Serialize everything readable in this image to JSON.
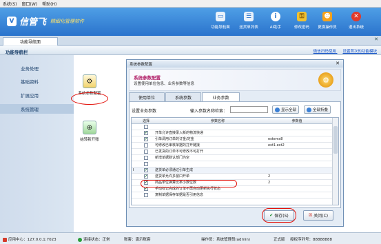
{
  "menu": [
    "系统(S)",
    "窗口(W)",
    "帮助(H)"
  ],
  "brand": {
    "name": "信管飞",
    "slogan": "精细化管理软件"
  },
  "toolbar": [
    {
      "label": "功能导航面",
      "icon": "monitor-icon",
      "color": "#ffffff"
    },
    {
      "label": "送货单列表",
      "icon": "list-icon",
      "color": "#ffffff"
    },
    {
      "label": "AI助手",
      "icon": "info-icon",
      "color": "#ffffff"
    },
    {
      "label": "修改密码",
      "icon": "key-icon",
      "color": "#f2c230"
    },
    {
      "label": "更换操作员",
      "icon": "user-icon",
      "color": "#f7a21b"
    },
    {
      "label": "退出系统",
      "icon": "close-icon",
      "color": "#e23a2a"
    }
  ],
  "tabs": {
    "home": "功能导航面"
  },
  "nav": {
    "title": "功能导航栏",
    "links": [
      "微信扫码使用",
      "设置首次的功能模块"
    ]
  },
  "sidebar": [
    "业务处理",
    "基础资料",
    "扩展应用",
    "系统管理"
  ],
  "functions": [
    {
      "label": "系统参数配置",
      "icon": "db-gear-icon"
    },
    {
      "label": "结转新开账",
      "icon": "db-add-icon"
    }
  ],
  "dialog": {
    "title": "系统参数配置",
    "header_title": "系统参数配置",
    "header_subtitle": "设置使用单位信息、业务参数等信息",
    "tabs": [
      "使用单位",
      "系统参数",
      "业务参数"
    ],
    "active_tab": 2,
    "set_label": "设置业务参数",
    "search_label": "输入参数名称检索：",
    "search_value": "",
    "show_all": "显示全部",
    "select_all": "全部折叠",
    "columns": [
      "选择",
      "参数名称",
      "参数值"
    ],
    "rows": [
      {
        "mark": "",
        "checked": false,
        "name": "",
        "value": ""
      },
      {
        "mark": "",
        "checked": true,
        "name": "开单允许直接录入新的物流快递",
        "value": ""
      },
      {
        "mark": "",
        "checked": true,
        "name": "引单调用订单的订金/定金",
        "value": "estems8"
      },
      {
        "mark": "",
        "checked": false,
        "name": "可修改已审核单据的打开链接",
        "value": "ext1.ext2"
      },
      {
        "mark": "",
        "checked": false,
        "name": "已发货的订单不可修改不可打开",
        "value": ""
      },
      {
        "mark": "",
        "checked": false,
        "name": "新增单据默认部门为空",
        "value": ""
      },
      {
        "mark": "",
        "checked": false,
        "name": "",
        "value": ""
      },
      {
        "mark": "I",
        "checked": true,
        "name": "送货单必须通过引单生成",
        "value": ""
      },
      {
        "mark": "",
        "checked": true,
        "name": "送货单允许多窗口开单",
        "value": "2"
      },
      {
        "mark": "",
        "checked": true,
        "name": "商品单位换算比率小数位数",
        "value": "2"
      },
      {
        "mark": "",
        "checked": true,
        "name": "手动标记完成的订单不再自动更新执行状态",
        "value": ""
      },
      {
        "mark": "",
        "checked": false,
        "name": "复制单据保存单据是否引用信息",
        "value": ""
      }
    ],
    "save": "保存(S)",
    "close": "关闭(C)"
  },
  "status": {
    "app_center": "应用中心：127.0.0.1:7023",
    "connection": "连接状态：正常",
    "account": "账套：演示账套",
    "operator": "操作员：系统管理员(admin)",
    "edition": "正式版",
    "license": "授权序列号：88888888"
  }
}
